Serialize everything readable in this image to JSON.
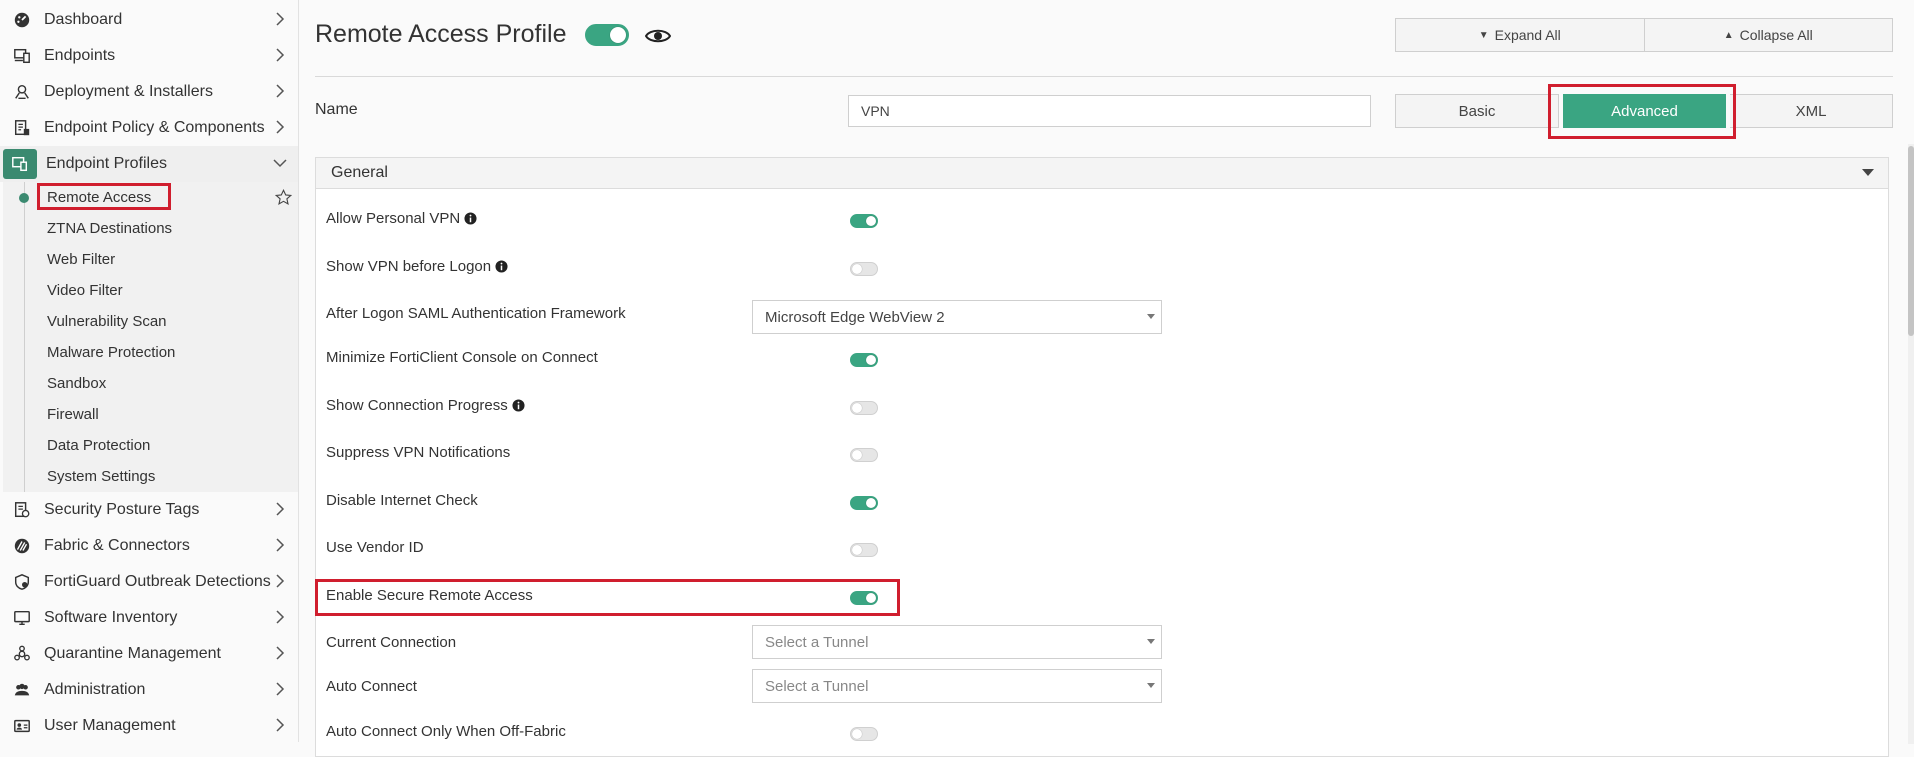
{
  "sidebar": {
    "items": [
      {
        "label": "Dashboard",
        "icon": "dashboard-icon"
      },
      {
        "label": "Endpoints",
        "icon": "endpoints-icon"
      },
      {
        "label": "Deployment & Installers",
        "icon": "deployment-icon"
      },
      {
        "label": "Endpoint Policy & Components",
        "icon": "policy-icon"
      },
      {
        "label": "Endpoint Profiles",
        "icon": "profiles-icon",
        "expanded": true
      }
    ],
    "sub_items": [
      {
        "label": "Remote Access",
        "selected": true
      },
      {
        "label": "ZTNA Destinations"
      },
      {
        "label": "Web Filter"
      },
      {
        "label": "Video Filter"
      },
      {
        "label": "Vulnerability Scan"
      },
      {
        "label": "Malware Protection"
      },
      {
        "label": "Sandbox"
      },
      {
        "label": "Firewall"
      },
      {
        "label": "Data Protection"
      },
      {
        "label": "System Settings"
      }
    ],
    "items_after": [
      {
        "label": "Security Posture Tags",
        "icon": "tags-icon"
      },
      {
        "label": "Fabric & Connectors",
        "icon": "fabric-icon"
      },
      {
        "label": "FortiGuard Outbreak Detections",
        "icon": "outbreak-icon"
      },
      {
        "label": "Software Inventory",
        "icon": "inventory-icon"
      },
      {
        "label": "Quarantine Management",
        "icon": "quarantine-icon"
      },
      {
        "label": "Administration",
        "icon": "admin-icon"
      },
      {
        "label": "User Management",
        "icon": "users-icon"
      }
    ]
  },
  "header": {
    "title": "Remote Access Profile",
    "enabled": true,
    "expand_all": "Expand All",
    "collapse_all": "Collapse All"
  },
  "name_row": {
    "label": "Name",
    "value": "VPN"
  },
  "modes": {
    "basic": "Basic",
    "advanced": "Advanced",
    "xml": "XML",
    "selected": "Advanced"
  },
  "general": {
    "title": "General",
    "rows": {
      "allow_personal_vpn": {
        "label": "Allow Personal VPN",
        "on": true
      },
      "show_vpn_before_logon": {
        "label": "Show VPN before Logon",
        "on": false
      },
      "saml_framework": {
        "label": "After Logon SAML Authentication Framework",
        "value": "Microsoft Edge WebView 2"
      },
      "minimize_console": {
        "label": "Minimize FortiClient Console on Connect",
        "on": true
      },
      "show_connection_progress": {
        "label": "Show Connection Progress",
        "on": false
      },
      "suppress_vpn_notifications": {
        "label": "Suppress VPN Notifications",
        "on": false
      },
      "disable_internet_check": {
        "label": "Disable Internet Check",
        "on": true
      },
      "use_vendor_id": {
        "label": "Use Vendor ID",
        "on": false
      },
      "enable_secure_remote_access": {
        "label": "Enable Secure Remote Access",
        "on": true
      },
      "current_connection": {
        "label": "Current Connection",
        "placeholder": "Select a Tunnel"
      },
      "auto_connect": {
        "label": "Auto Connect",
        "placeholder": "Select a Tunnel"
      },
      "auto_connect_off_fabric": {
        "label": "Auto Connect Only When Off-Fabric",
        "on": false
      }
    }
  },
  "colors": {
    "accent": "#3aa582",
    "active_icon_bg": "#3b8a70",
    "highlight": "#d01e2e"
  }
}
